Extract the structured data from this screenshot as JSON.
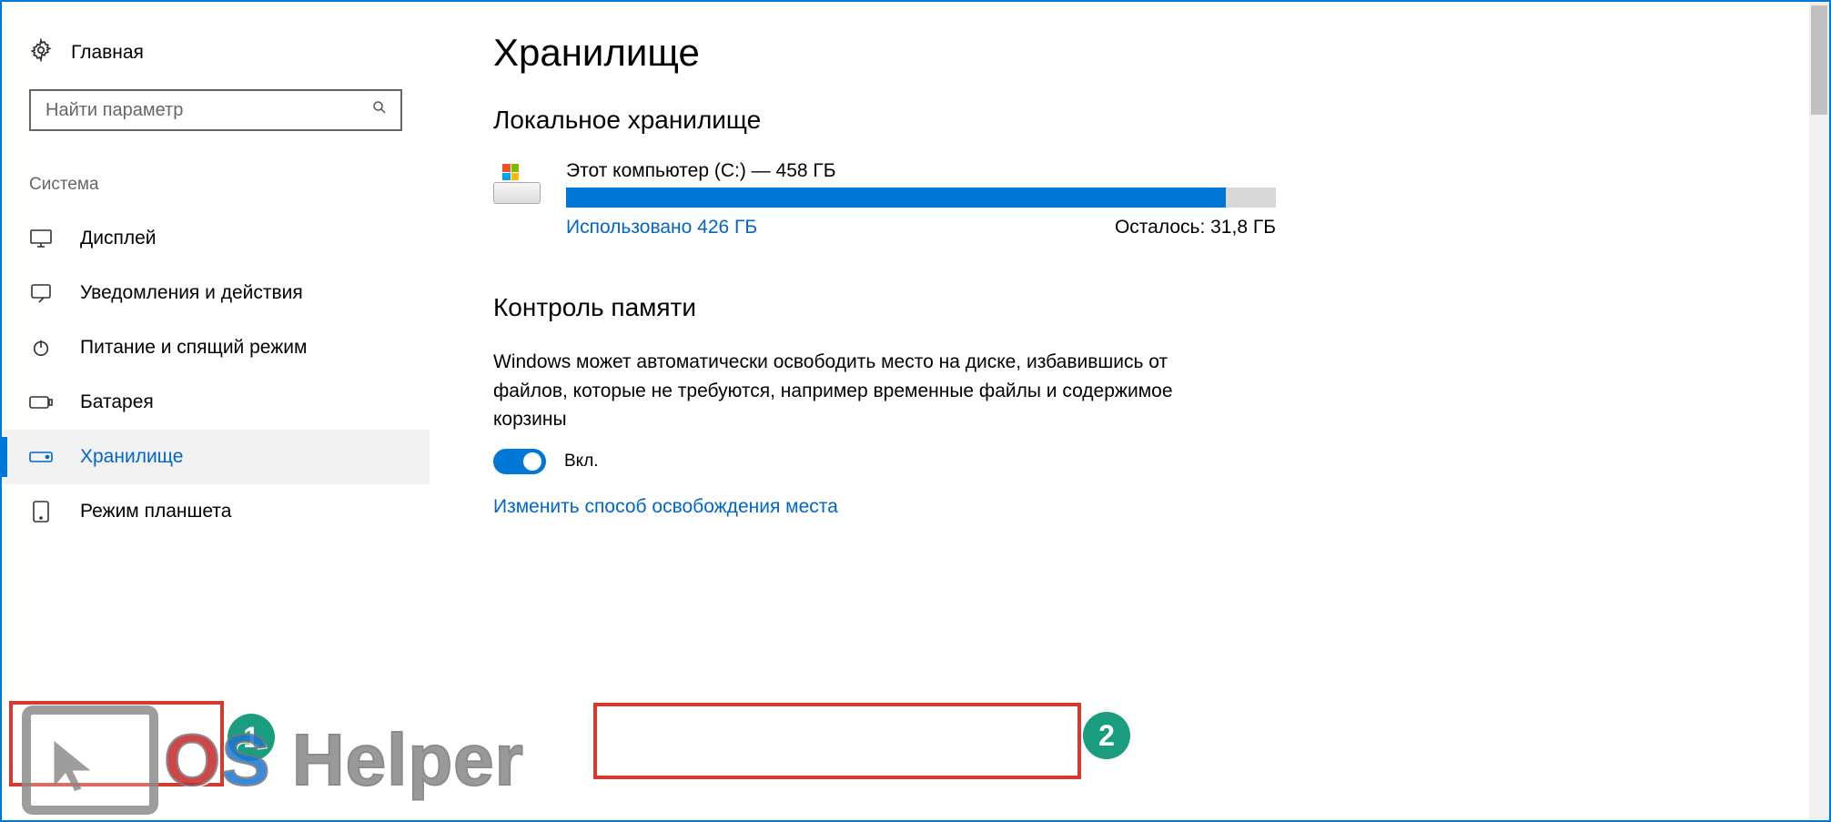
{
  "sidebar": {
    "home": "Главная",
    "search_placeholder": "Найти параметр",
    "section": "Система",
    "items": [
      {
        "label": "Дисплей"
      },
      {
        "label": "Уведомления и действия"
      },
      {
        "label": "Питание и спящий режим"
      },
      {
        "label": "Батарея"
      },
      {
        "label": "Хранилище"
      },
      {
        "label": "Режим планшета"
      }
    ]
  },
  "main": {
    "title": "Хранилище",
    "local_heading": "Локальное хранилище",
    "drive": {
      "title": "Этот компьютер (C:) — 458 ГБ",
      "used_label": "Использовано 426 ГБ",
      "remaining_label": "Осталось: 31,8 ГБ",
      "used_percent": 93
    },
    "sense_heading": "Контроль памяти",
    "sense_desc": "Windows может автоматически освободить место на диске, избавившись от файлов, которые не требуются, например временные файлы и содержимое корзины",
    "toggle_label": "Вкл.",
    "change_link": "Изменить способ освобождения места"
  },
  "annotations": {
    "badge1": "1",
    "badge2": "2"
  },
  "watermark": {
    "o": "O",
    "s": "S",
    "rest": " Helper"
  }
}
